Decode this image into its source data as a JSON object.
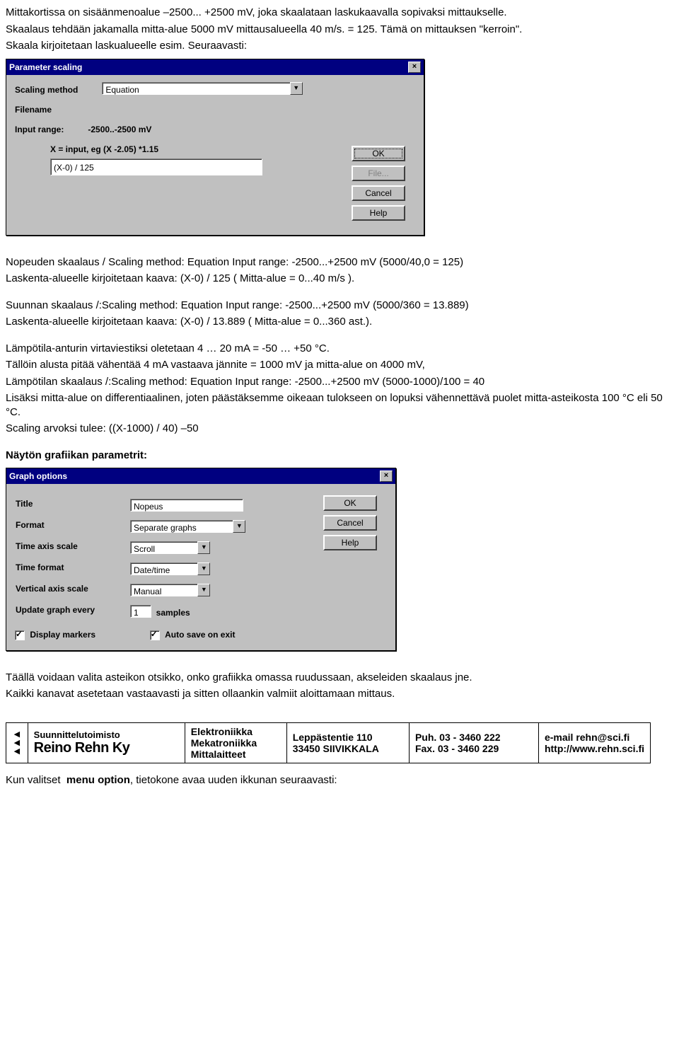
{
  "intro": {
    "p1a": "Mittakortissa on sisäänmenoalue –2500... +2500 mV, joka skaalataan laskukaavalla sopivaksi mittaukselle.",
    "p1b": "Skaalaus tehdään jakamalla mitta-alue 5000 mV mittausalueella 40 m/s. = 125. Tämä on mittauksen \"kerroin\".",
    "p1c": "Skaala kirjoitetaan laskualueelle esim. Seuraavasti:"
  },
  "dlg1": {
    "title": "Parameter scaling",
    "scaling_method_label": "Scaling method",
    "scaling_method_value": "Equation",
    "filename_label": "Filename",
    "input_range_label": "Input range:",
    "input_range_value": "-2500..-2500 mV",
    "x_label": "X = input, eg (X -2.05) *1.15",
    "formula": "(X-0) / 125",
    "btn_ok": "OK",
    "btn_file": "File...",
    "btn_cancel": "Cancel",
    "btn_help": "Help"
  },
  "mid": {
    "np1": "Nopeuden skaalaus / Scaling method: Equation  Input range: -2500...+2500 mV (5000/40,0 = 125)",
    "np2": "Laskenta-alueelle kirjoitetaan kaava: (X-0) / 125  ( Mitta-alue  = 0...40 m/s ).",
    "su1": "Suunnan skaalaus /:Scaling method: Equation  Input range: -2500...+2500 mV  (5000/360 = 13.889)",
    "su2": "Laskenta-alueelle kirjoitetaan kaava: (X-0) / 13.889 ( Mitta-alue = 0...360 ast.).",
    "la1": "Lämpötila-anturin virtaviestiksi oletetaan 4 … 20 mA  = -50 … +50 °C.",
    "la2": "Tällöin alusta pitää vähentää 4 mA vastaava jännite = 1000 mV ja mitta-alue on 4000 mV,",
    "la3": "Lämpötilan skaalaus /:Scaling method: Equation  Input range: -2500...+2500 mV  (5000-1000)/100 = 40",
    "la4": "Lisäksi mitta-alue on differentiaalinen, joten päästäksemme oikeaan tulokseen on lopuksi vähennettävä puolet mitta-asteikosta 100 °C eli 50 °C.",
    "la5": "Scaling arvoksi tulee: ((X-1000) / 40) –50",
    "heading": "Näytön grafiikan parametrit:"
  },
  "dlg2": {
    "title": "Graph options",
    "title_label": "Title",
    "title_value": "Nopeus",
    "format_label": "Format",
    "format_value": "Separate graphs",
    "time_axis_label": "Time axis scale",
    "time_axis_value": "Scroll",
    "time_format_label": "Time format",
    "time_format_value": "Date/time",
    "vertical_label": "Vertical axis scale",
    "vertical_value": "Manual",
    "update_label": "Update graph every",
    "update_value": "1",
    "samples_label": "samples",
    "display_markers": "Display markers",
    "auto_save": "Auto save on exit",
    "btn_ok": "OK",
    "btn_cancel": "Cancel",
    "btn_help": "Help"
  },
  "after": {
    "p1": "Täällä voidaan valita asteikon otsikko, onko grafiikka omassa ruudussaan, akseleiden skaalaus jne.",
    "p2": "Kaikki kanavat asetetaan vastaavasti ja sitten ollaankin valmiit aloittamaan mittaus."
  },
  "footer": {
    "brand_small": "Suunnittelutoimisto",
    "brand_big": "Reino Rehn Ky",
    "col2a": "Elektroniikka",
    "col2b": "Mekatroniikka",
    "col2c": "Mittalaitteet",
    "col3a": "Leppästentie 110",
    "col3b": "33450 SIIVIKKALA",
    "col4a": "Puh.   03 - 3460 222",
    "col4b": "Fax.   03 - 3460 229",
    "col5a": "e-mail rehn@sci.fi",
    "col5b": "http://www.rehn.sci.fi"
  },
  "last": {
    "p": "Kun valitset  menu option, tietokone avaa uuden ikkunan seuraavasti:",
    "bold": "menu option"
  }
}
